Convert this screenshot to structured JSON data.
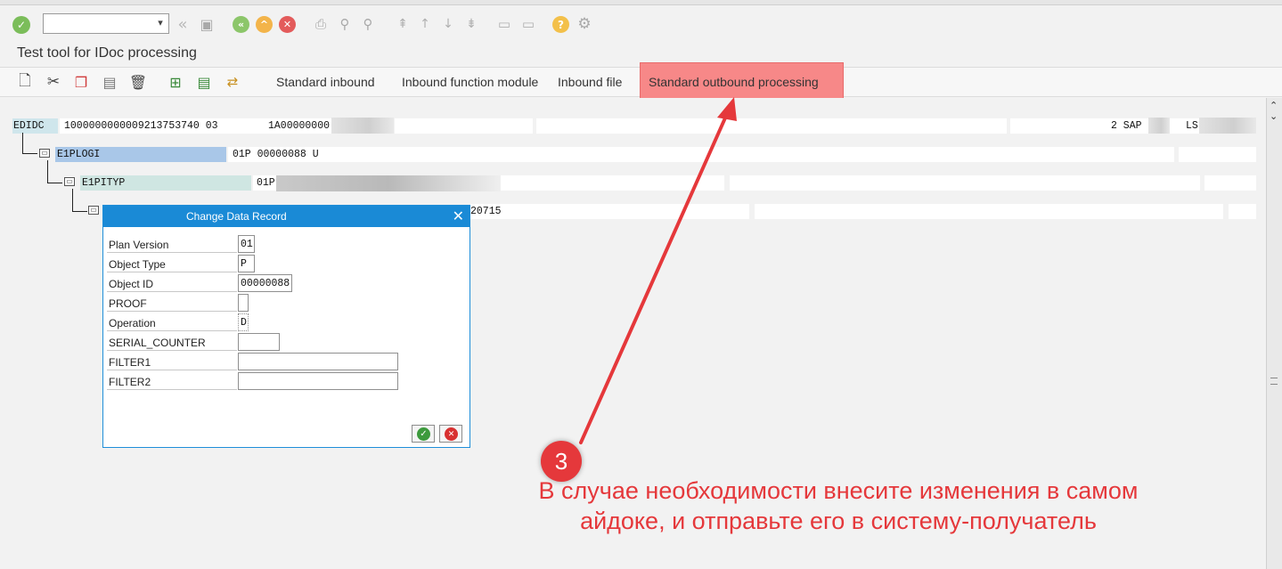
{
  "title": "Test tool for IDoc processing",
  "toolbar": {
    "buttons": [
      "Standard inbound",
      "Inbound function module",
      "Inbound file",
      "Standard outbound processing"
    ],
    "active": "Standard outbound processing"
  },
  "tree": {
    "edidc": {
      "name": "EDIDC",
      "text1": "1000000000009213753740 03",
      "text2": "1A00000000",
      "text3": "2 SAP",
      "text4": "LS"
    },
    "e1plogi": {
      "name": "E1PLOGI",
      "text": "01P 00000088 U"
    },
    "e1pityp": {
      "name": "E1PITYP",
      "text": "01P"
    },
    "row4": {
      "text": "20715"
    }
  },
  "dialog": {
    "title": "Change Data Record",
    "fields": [
      {
        "label": "Plan Version",
        "value": "01"
      },
      {
        "label": "Object Type",
        "value": "P"
      },
      {
        "label": "Object ID",
        "value": "00000088"
      },
      {
        "label": "PROOF",
        "value": ""
      },
      {
        "label": "Operation",
        "value": "D"
      },
      {
        "label": "SERIAL_COUNTER",
        "value": ""
      },
      {
        "label": "FILTER1",
        "value": ""
      },
      {
        "label": "FILTER2",
        "value": ""
      }
    ]
  },
  "annotation": {
    "number": "3",
    "line1": "В случае необходимости внесите изменения в самом",
    "line2": "айдоке, и отправьте его в систему-получатель"
  },
  "colors": {
    "accent": "#1a8ad6",
    "annotation": "#e5383b",
    "highlight": "#f78888"
  }
}
